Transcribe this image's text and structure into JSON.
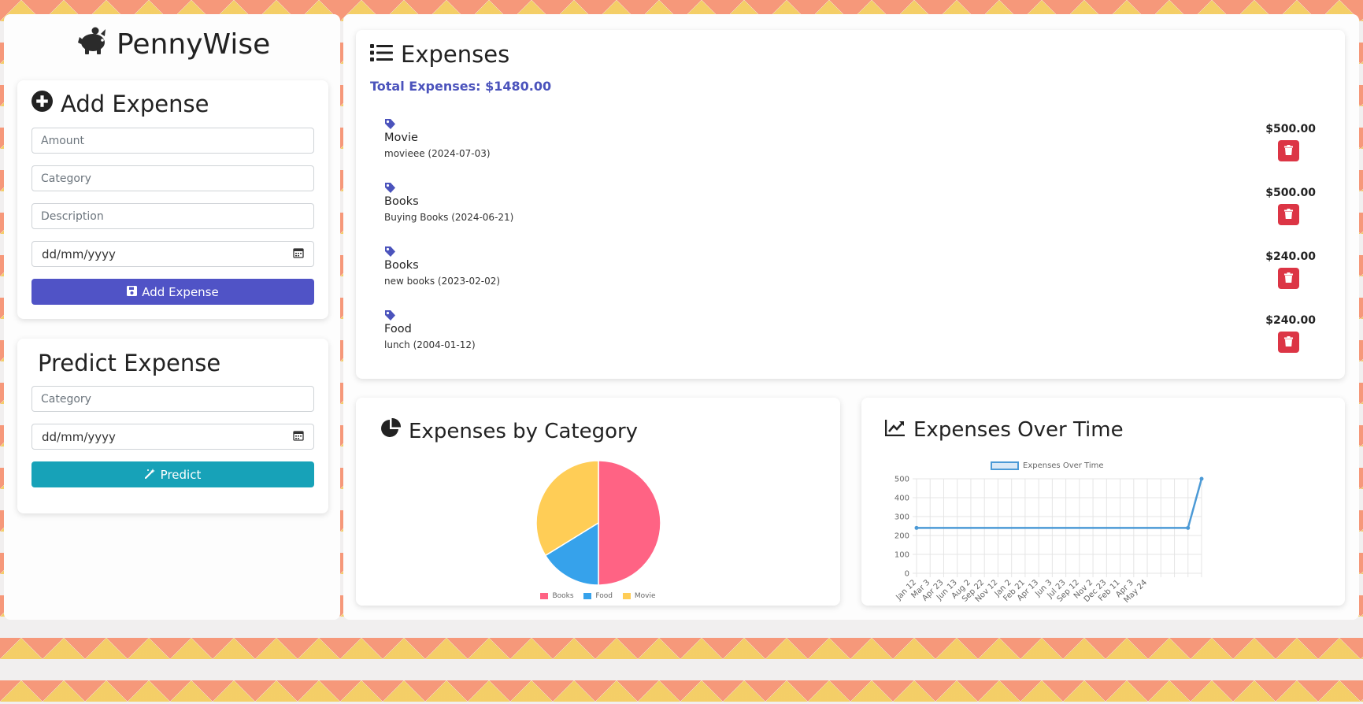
{
  "brand": {
    "name": "PennyWise"
  },
  "add_expense": {
    "title": "Add Expense",
    "amount_placeholder": "Amount",
    "category_placeholder": "Category",
    "description_placeholder": "Description",
    "date_placeholder": "dd/mm/yyyy",
    "submit_label": "Add Expense",
    "accent_color": "#5053c6"
  },
  "predict_expense": {
    "title": "Predict Expense",
    "category_placeholder": "Category",
    "date_placeholder": "dd/mm/yyyy",
    "submit_label": "Predict",
    "accent_color": "#17a2b8"
  },
  "expenses": {
    "title": "Expenses",
    "total_label": "Total Expenses: $1480.00",
    "items": [
      {
        "category": "Movie",
        "description": "movieee (2024-07-03)",
        "amount": "$500.00"
      },
      {
        "category": "Books",
        "description": "Buying Books (2024-06-21)",
        "amount": "$500.00"
      },
      {
        "category": "Books",
        "description": "new books (2023-02-02)",
        "amount": "$240.00"
      },
      {
        "category": "Food",
        "description": "lunch (2004-01-12)",
        "amount": "$240.00"
      }
    ]
  },
  "category_chart": {
    "title": "Expenses by Category",
    "chart_data": {
      "type": "pie",
      "categories": [
        "Books",
        "Food",
        "Movie"
      ],
      "values": [
        740,
        240,
        500
      ],
      "colors": [
        "#ff6384",
        "#36a2eb",
        "#ffcd56"
      ],
      "legend": "bottom"
    }
  },
  "time_chart": {
    "title": "Expenses Over Time",
    "chart_data": {
      "type": "line",
      "series": [
        {
          "name": "Expenses Over Time",
          "values": [
            240,
            240,
            240,
            240,
            240,
            240,
            240,
            240,
            240,
            240,
            240,
            240,
            240,
            240,
            240,
            240,
            240,
            240,
            240,
            240,
            240,
            500
          ]
        }
      ],
      "categories": [
        "Jan 12",
        "Mar 3",
        "Apr 23",
        "Jun 13",
        "Aug 2",
        "Sep 22",
        "Nov 12",
        "Jan 2",
        "Feb 21",
        "Apr 13",
        "Jun 3",
        "Jul 23",
        "Sep 12",
        "Nov 2",
        "Dec 23",
        "Feb 11",
        "Apr 3",
        "May 24"
      ],
      "ylim": [
        0,
        500
      ],
      "yticks": [
        0,
        100,
        200,
        300,
        400,
        500
      ],
      "color": "#4c9ad6",
      "grid": true,
      "legend": "top"
    }
  }
}
